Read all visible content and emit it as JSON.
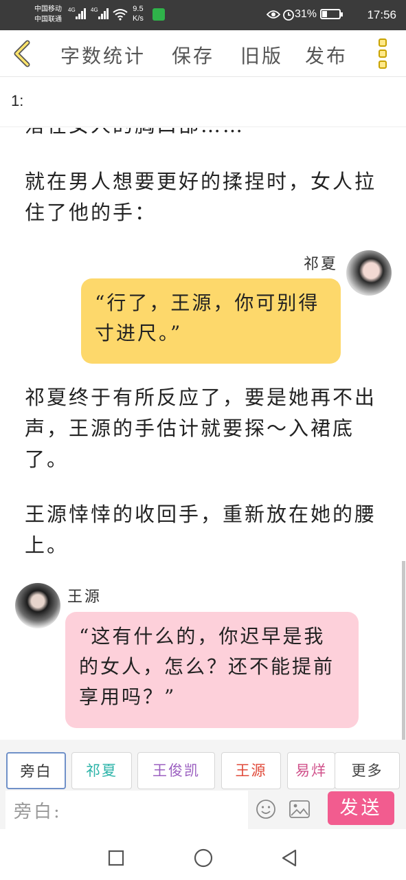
{
  "status_bar": {
    "carrier_1": "中国移动",
    "carrier_2": "中国联通",
    "net_1": "4G",
    "net_2": "4G",
    "speed_value": "9.5",
    "speed_unit": "K/s",
    "battery_text": "31%",
    "battery_level": 0.31,
    "time": "17:56"
  },
  "toolbar": {
    "word_count": "字数统计",
    "save": "保存",
    "old_version": "旧版",
    "publish": "发布"
  },
  "chapter_label": "1:",
  "content": {
    "para_partial": "落在女人的胸口部……",
    "para_1": "就在男人想要更好的揉捏时，女人拉住了他的手：",
    "speaker_1": "祁夏",
    "bubble_1": "“行了，王源，你可别得寸进尺。”",
    "para_2": "祁夏终于有所反应了，要是她再不出声，王源的手估计就要探～入裙底了。",
    "para_3": "王源悻悻的收回手，重新放在她的腰上。",
    "speaker_2": "王源",
    "bubble_2": "“这有什么的，你迟早是我的女人，怎么？还不能提前享用吗？”"
  },
  "characters": [
    {
      "label": "旁白",
      "color": "#333333"
    },
    {
      "label": "祁夏",
      "color": "#2bb3a8"
    },
    {
      "label": "王俊凯",
      "color": "#9b5fc0"
    },
    {
      "label": "王源",
      "color": "#e04a3a"
    },
    {
      "label": "易烊",
      "color": "#d0508a"
    },
    {
      "label": "更多",
      "color": "#444444"
    }
  ],
  "input": {
    "placeholder": "旁白:",
    "send_label": "发送"
  },
  "colors": {
    "bubble_yellow": "#fdd86b",
    "bubble_pink": "#fdd0da",
    "send_pink": "#f25c8f",
    "back_accent": "#e0b500"
  }
}
